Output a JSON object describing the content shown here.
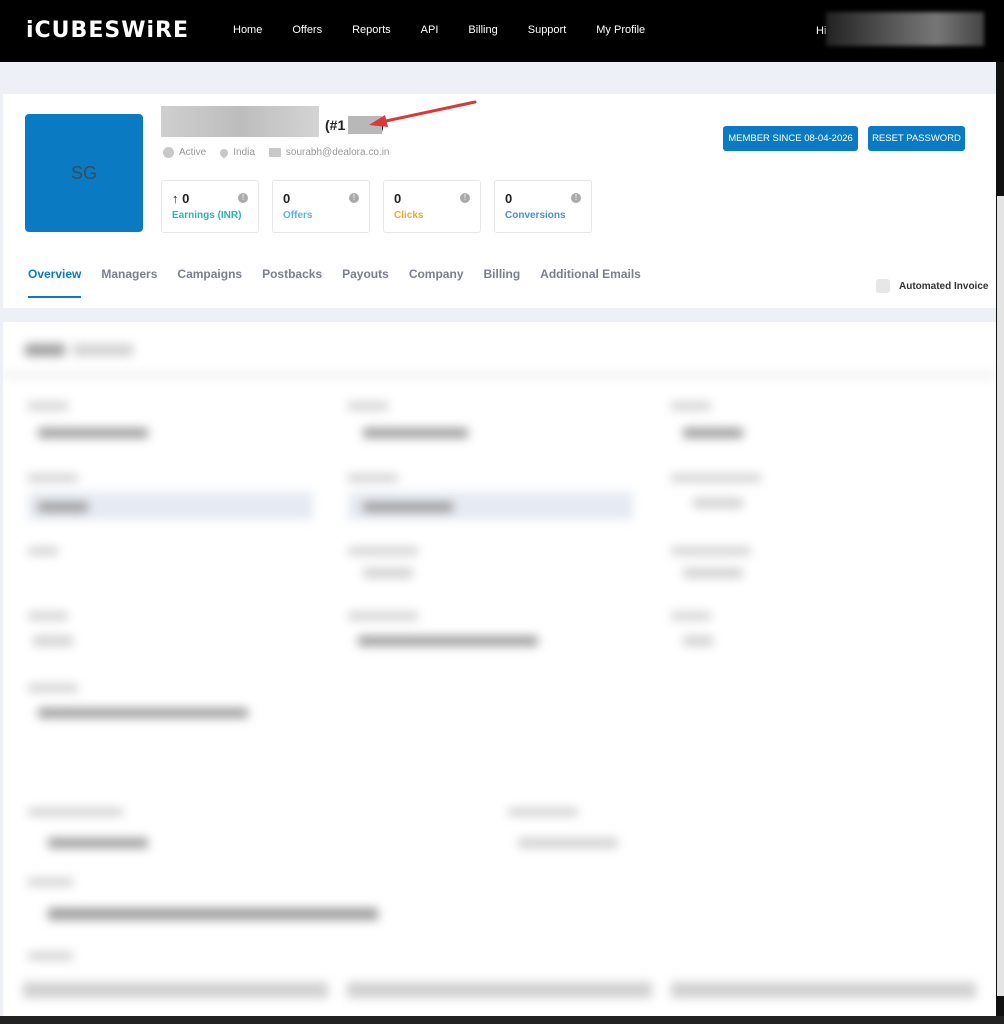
{
  "nav": {
    "logo": "iCUBESWiRE",
    "items": [
      "Home",
      "Offers",
      "Reports",
      "API",
      "Billing",
      "Support",
      "My Profile"
    ],
    "greeting": "Hi"
  },
  "profile": {
    "initials": "SG",
    "id_prefix": "(#1",
    "id_suffix": ")",
    "status": "Active",
    "country": "India",
    "email": "sourabh@dealora.co.in",
    "member_since_button": "MEMBER SINCE 08-04-2026",
    "reset_password_button": "RESET PASSWORD",
    "stats": [
      {
        "value": "0",
        "label": "Earnings (INR)",
        "color": "#2bb3b1",
        "prefix": "↑"
      },
      {
        "value": "0",
        "label": "Offers",
        "color": "#5ab4e0",
        "prefix": ""
      },
      {
        "value": "0",
        "label": "Clicks",
        "color": "#f0a92e",
        "prefix": ""
      },
      {
        "value": "0",
        "label": "Conversions",
        "color": "#4a90d9",
        "prefix": ""
      }
    ]
  },
  "tabs": [
    "Overview",
    "Managers",
    "Campaigns",
    "Postbacks",
    "Payouts",
    "Company",
    "Billing",
    "Additional Emails"
  ],
  "automated_invoice_label": "Automated Invoice",
  "colors": {
    "accent": "#0a7bc3",
    "nav_bg": "#000000",
    "page_bg": "#eef0f8"
  }
}
